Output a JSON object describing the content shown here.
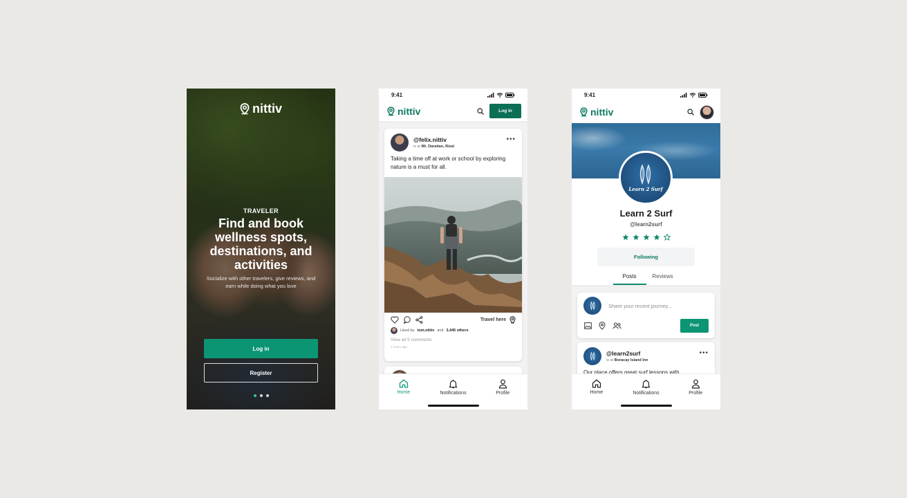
{
  "brand": {
    "name": "nittiv",
    "accent": "#0b9573",
    "dark_accent": "#0b6f56"
  },
  "status_bar": {
    "time": "9:41"
  },
  "onboarding": {
    "kicker": "TRAVELER",
    "title": "Find and book wellness spots, destinations, and activities",
    "subtitle": "Socialize with other travelers, give reviews, and earn while doing what you love",
    "login_label": "Log in",
    "register_label": "Register",
    "pager_active": 1,
    "pager_total": 3
  },
  "feed": {
    "header_login_label": "Log in",
    "post": {
      "username": "@felix.nittiv",
      "location_prefix": "is at",
      "location": "Mt. Daraitan, Rizal",
      "text": "Taking a time off at work or school by exploring nature is a must for all.",
      "travel_here_label": "Travel here",
      "liked_prefix": "Liked by",
      "liked_user": "tom.nittiv",
      "liked_and": "and",
      "liked_others": "2,445 others",
      "view_comments": "View all 5 comments",
      "time_ago": "1 hours ago"
    },
    "nav": [
      {
        "label": "Home",
        "icon": "home-icon"
      },
      {
        "label": "Notifications",
        "icon": "bell-icon"
      },
      {
        "label": "Profile",
        "icon": "profile-icon"
      }
    ]
  },
  "profile": {
    "badge_text": "Learn 2 Surf",
    "name": "Learn 2 Surf",
    "handle": "@learn2surf",
    "rating": 4,
    "rating_max": 5,
    "follow_label": "Following",
    "tabs": [
      {
        "label": "Posts",
        "active": true
      },
      {
        "label": "Reviews",
        "active": false
      }
    ],
    "composer_placeholder": "Share your recent journey...",
    "post_button": "Post",
    "post": {
      "username": "@learn2surf",
      "location_prefix": "is at",
      "location": "Boracay Island Inn",
      "text": "Our place offers great surf lessons with"
    },
    "nav": [
      {
        "label": "Home",
        "icon": "home-icon"
      },
      {
        "label": "Notifications",
        "icon": "bell-icon"
      },
      {
        "label": "Profile",
        "icon": "profile-icon"
      }
    ]
  }
}
